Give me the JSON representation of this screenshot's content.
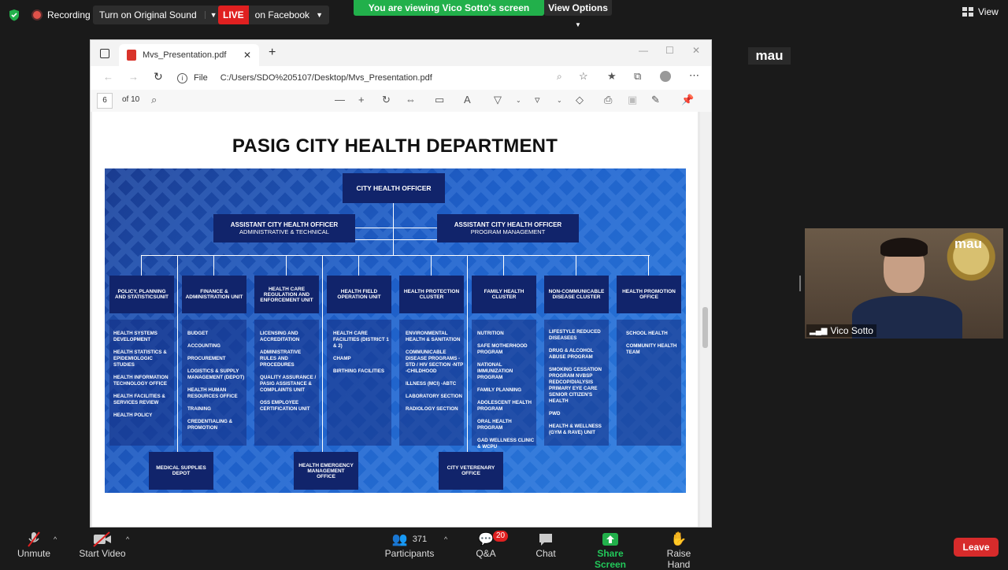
{
  "meeting": {
    "recording": "Recording",
    "original_sound": "Turn on Original Sound",
    "live_badge": "LIVE",
    "live_target": "on Facebook",
    "viewing_banner": "You are viewing Vico Sotto's screen",
    "view_options": "View Options",
    "view_button": "View"
  },
  "browser": {
    "tab_title": "Mvs_Presentation.pdf",
    "url_prefix": "File",
    "url": "C:/Users/SDO%205107/Desktop/Mvs_Presentation.pdf",
    "page_current": "6",
    "page_total": "of 10"
  },
  "slide": {
    "title": "PASIG CITY HEALTH DEPARTMENT",
    "top": "CITY HEALTH OFFICER",
    "asst_left_title": "ASSISTANT CITY HEALTH OFFICER",
    "asst_left_sub": "ADMINISTRATIVE & TECHNICAL",
    "asst_right_title": "ASSISTANT CITY HEALTH OFFICER",
    "asst_right_sub": "PROGRAM MANAGEMENT",
    "units": [
      {
        "name": "POLICY, PLANNING AND STATISTICSUNIT",
        "items": [
          "HEALTH SYSTEMS DEVELOPMENT",
          "HEALTH STATISTICS & EPIDEMIOLOGIC STUDIES",
          "HEALTH INFORMATION TECHNOLOGY OFFICE",
          "HEALTH FACILITIES & SERVICES REVIEW",
          "HEALTH POLICY"
        ]
      },
      {
        "name": "FINANCE & ADMINISTRATION UNIT",
        "items": [
          "BUDGET",
          "ACCOUNTING",
          "PROCUREMENT",
          "LOGISTICS & SUPPLY MANAGEMENT (DEPOT)",
          "HEALTH HUMAN RESOURCES OFFICE",
          "TRAINING",
          "CREDENTIALING & PROMOTION"
        ]
      },
      {
        "name": "HEALTH CARE REGULATION AND ENFORCEMENT UNIT",
        "items": [
          "LICENSING AND ACCREDITATION",
          "ADMINISTRATIVE RULES AND PROCEDURES",
          "QUALITY ASSURANCE / PASIG ASSISTANCE & COMPLAINTS UNIT",
          "OSS EMPLOYEE CERTIFICATION UNIT"
        ]
      },
      {
        "name": "HEALTH FIELD OPERATION UNIT",
        "items": [
          "HEALTH CARE FACILITIES (DISTRICT 1 & 2)",
          "CHAMP",
          "BIRTHING FACILITIES"
        ]
      },
      {
        "name": "HEALTH PROTECTION CLUSTER",
        "items": [
          "ENVIRONMENTAL HEALTH & SANITATION",
          "COMMUNICABLE DISEASE PROGRAMS -STD / HIV SECTION -NTP -CHILDHOOD",
          "ILLNESS (MCI) -ABTC",
          "LABORATORY SECTION",
          "RADIOLOGY SECTION"
        ]
      },
      {
        "name": "FAMILY HEALTH CLUSTER",
        "items": [
          "NUTRITION",
          "SAFE MOTHERHOOD PROGRAM",
          "NATIONAL IMMUNIZATION PROGRAM",
          "FAMILY PLANNING",
          "ADOLESCENT HEALTH PROGRAM",
          "ORAL HEALTH PROGRAM",
          "GAD WELLNESS CLINIC & WCPU"
        ]
      },
      {
        "name": "NON-COMMUNICABLE DISEASE CLUSTER",
        "items": [
          "LIFESTYLE REDUCED DISEASEES",
          "DRUG & ALCOHOL ABUSE PROGRAM",
          "SMOKING CESSATION PROGRAM NVBSP REDCOP/DIALYSIS PRIMARY EYE CARE SENIOR CITIZEN'S HEALTH",
          "PWD",
          "HEALTH & WELLNESS (GYM & RAVE) UNIT"
        ]
      },
      {
        "name": "HEALTH PROMOTION OFFICE",
        "items": [
          "SCHOOL HEALTH",
          "COMMUNITY HEALTH TEAM"
        ]
      }
    ],
    "bottom_units": [
      "MEDICAL SUPPLIES DEPOT",
      "HEALTH EMERGENCY MANAGEMENT OFFICE",
      "CITY VETERENARY OFFICE"
    ]
  },
  "participant": {
    "name": "Vico Sotto",
    "label": "mau"
  },
  "controls": {
    "unmute": "Unmute",
    "start_video": "Start Video",
    "participants": "Participants",
    "participants_count": "371",
    "qa": "Q&A",
    "qa_badge": "20",
    "chat": "Chat",
    "share_screen": "Share Screen",
    "raise_hand": "Raise Hand",
    "leave": "Leave"
  }
}
